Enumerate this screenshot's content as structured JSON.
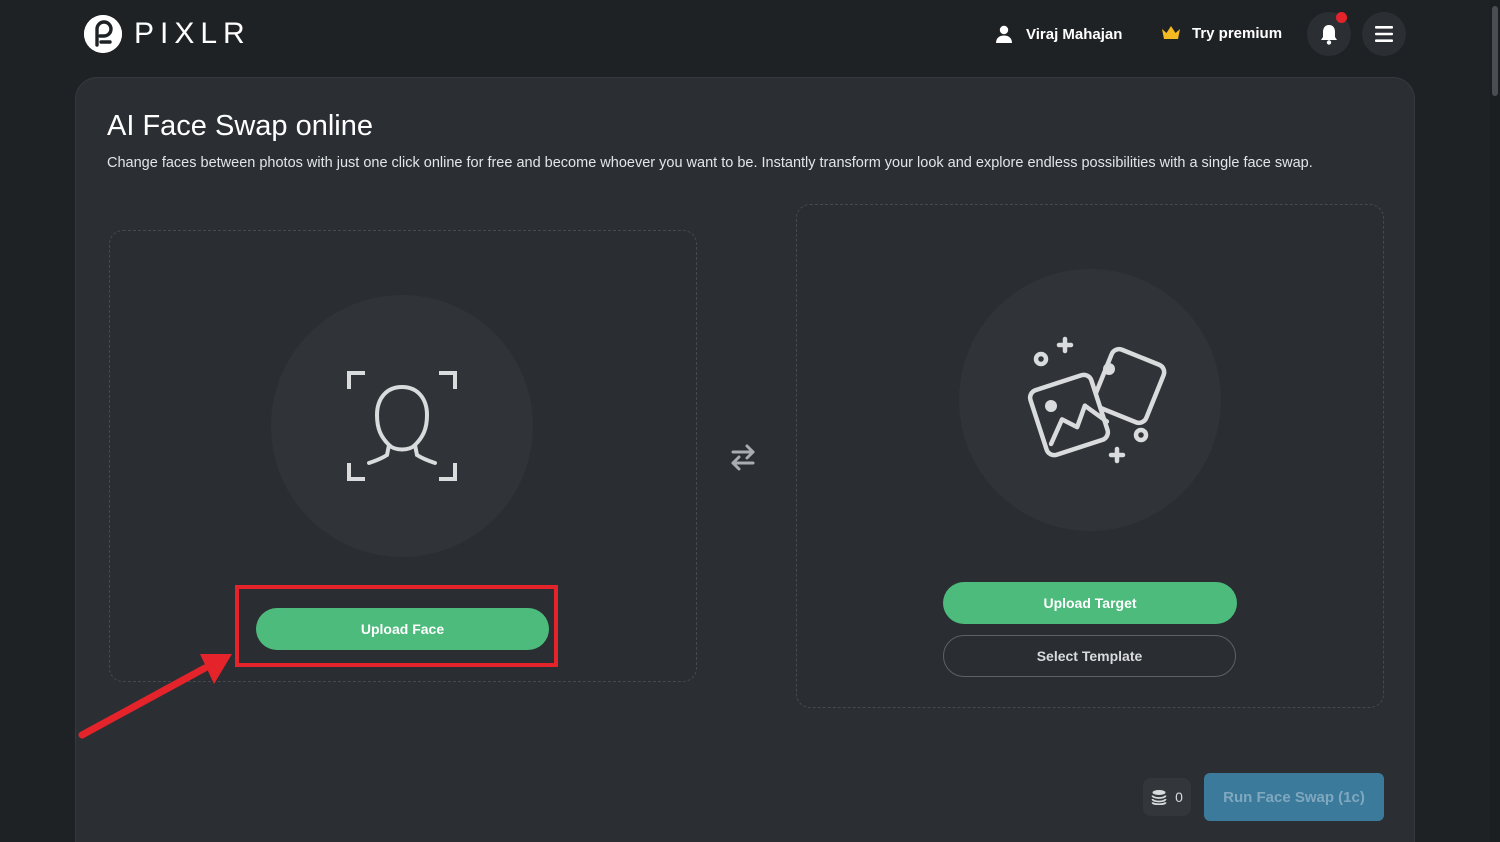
{
  "header": {
    "logo_text": "PIXLR",
    "user_name": "Viraj Mahajan",
    "premium_label": "Try premium"
  },
  "main": {
    "title": "AI Face Swap online",
    "description": "Change faces between photos with just one click online for free and become whoever you want to be. Instantly transform your look and explore endless possibilities with a single face swap.",
    "face_panel": {
      "upload_label": "Upload Face",
      "icon": "face-scan-icon"
    },
    "target_panel": {
      "upload_label": "Upload Target",
      "template_label": "Select Template",
      "icon": "images-icon"
    },
    "swap_icon": "swap-arrows-icon",
    "credits_count": "0",
    "run_label": "Run Face Swap (1c)"
  },
  "colors": {
    "background": "#1f2225",
    "card": "#2b2f33",
    "accent_green": "#4cbb7c",
    "run_button": "#3c7a9c",
    "annotation_red": "#e5232b",
    "crown": "#f5b921"
  }
}
